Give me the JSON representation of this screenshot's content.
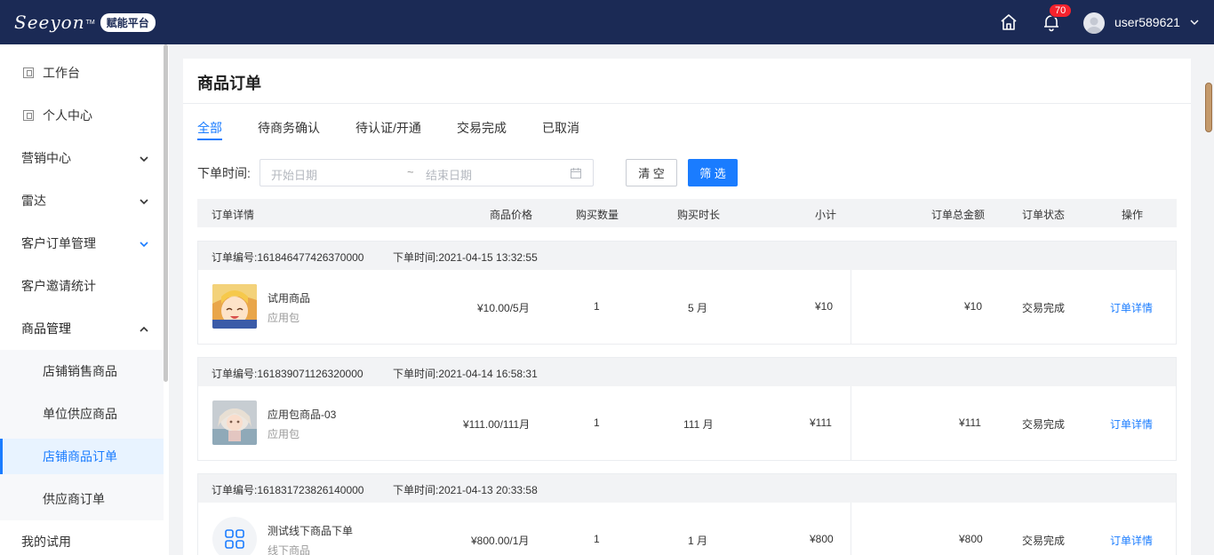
{
  "header": {
    "logo": "Seeyon",
    "logo_tm": "TM",
    "platform": "赋能平台",
    "notification_count": "70",
    "username": "user589621",
    "icons": [
      "home-icon",
      "bell-icon",
      "avatar",
      "chevron-down-icon"
    ]
  },
  "sidebar": {
    "items": [
      {
        "label": "工作台"
      },
      {
        "label": "个人中心"
      },
      {
        "label": "营销中心"
      },
      {
        "label": "雷达"
      },
      {
        "label": "客户订单管理"
      },
      {
        "label": "客户邀请统计"
      },
      {
        "label": "商品管理"
      },
      {
        "label": "店铺销售商品"
      },
      {
        "label": "单位供应商品"
      },
      {
        "label": "店铺商品订单"
      },
      {
        "label": "供应商订单"
      },
      {
        "label": "我的试用"
      }
    ]
  },
  "main": {
    "title": "商品订单",
    "tabs": [
      {
        "label": "全部"
      },
      {
        "label": "待商务确认"
      },
      {
        "label": "待认证/开通"
      },
      {
        "label": "交易完成"
      },
      {
        "label": "已取消"
      }
    ],
    "filter": {
      "label": "下单时间:",
      "start_placeholder": "开始日期",
      "separator": "~",
      "end_placeholder": "结束日期",
      "clear_label": "清 空",
      "filter_label": "筛 选"
    },
    "columns": [
      "订单详情",
      "商品价格",
      "购买数量",
      "购买时长",
      "小计",
      "订单总金额",
      "订单状态",
      "操作"
    ],
    "orders": [
      {
        "order_no": "订单编号:161846477426370000",
        "order_time": "下单时间:2021-04-15 13:32:55",
        "name": "试用商品",
        "type": "应用包",
        "price": "¥10.00/5月",
        "qty": "1",
        "duration": "5 月",
        "subtotal": "¥10",
        "total": "¥10",
        "status": "交易完成",
        "action": "订单详情"
      },
      {
        "order_no": "订单编号:161839071126320000",
        "order_time": "下单时间:2021-04-14 16:58:31",
        "name": "应用包商品-03",
        "type": "应用包",
        "price": "¥111.00/111月",
        "qty": "1",
        "duration": "111 月",
        "subtotal": "¥111",
        "total": "¥111",
        "status": "交易完成",
        "action": "订单详情"
      },
      {
        "order_no": "订单编号:161831723826140000",
        "order_time": "下单时间:2021-04-13 20:33:58",
        "name": "测试线下商品下单",
        "type": "线下商品",
        "price": "¥800.00/1月",
        "qty": "1",
        "duration": "1 月",
        "subtotal": "¥800",
        "total": "¥800",
        "status": "交易完成",
        "action": "订单详情"
      }
    ]
  },
  "colors": {
    "header_bg": "#1b2a55",
    "accent": "#1a7cff"
  }
}
